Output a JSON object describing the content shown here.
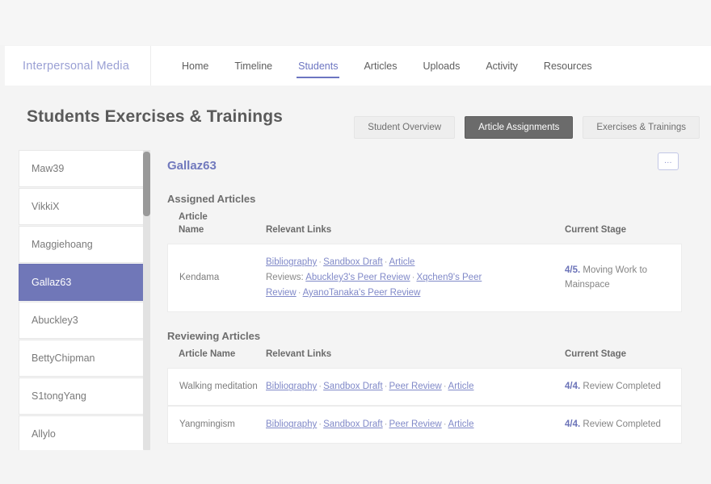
{
  "nav": {
    "brand": "Interpersonal Media",
    "links": [
      {
        "label": "Home",
        "active": false
      },
      {
        "label": "Timeline",
        "active": false
      },
      {
        "label": "Students",
        "active": true
      },
      {
        "label": "Articles",
        "active": false
      },
      {
        "label": "Uploads",
        "active": false
      },
      {
        "label": "Activity",
        "active": false
      },
      {
        "label": "Resources",
        "active": false
      }
    ]
  },
  "header": {
    "title": "Students Exercises & Trainings",
    "tabs": [
      {
        "label": "Student Overview",
        "active": false
      },
      {
        "label": "Article Assignments",
        "active": true
      },
      {
        "label": "Exercises & Trainings",
        "active": false
      }
    ]
  },
  "sidebar": {
    "students": [
      {
        "name": "Maw39",
        "selected": false
      },
      {
        "name": "VikkiX",
        "selected": false
      },
      {
        "name": "Maggiehoang",
        "selected": false
      },
      {
        "name": "Gallaz63",
        "selected": true
      },
      {
        "name": "Abuckley3",
        "selected": false
      },
      {
        "name": "BettyChipman",
        "selected": false
      },
      {
        "name": "S1tongYang",
        "selected": false
      },
      {
        "name": "Allylo",
        "selected": false
      }
    ]
  },
  "main": {
    "student_name": "Gallaz63",
    "more_button_label": "...",
    "assigned": {
      "section_title": "Assigned Articles",
      "headers": {
        "name_line1": "Article",
        "name_line2": "Name",
        "links": "Relevant Links",
        "stage": "Current Stage"
      },
      "rows": [
        {
          "name": "Kendama",
          "links": [
            "Bibliography",
            "Sandbox Draft",
            "Article"
          ],
          "reviews_label": "Reviews:",
          "review_links": [
            "Abuckley3's Peer Review",
            "Xqchen9's Peer Review",
            "AyanoTanaka's Peer Review"
          ],
          "stage_num": "4/5.",
          "stage_text": "Moving Work to Mainspace"
        }
      ]
    },
    "reviewing": {
      "section_title": "Reviewing Articles",
      "headers": {
        "name": "Article Name",
        "links": "Relevant Links",
        "stage": "Current Stage"
      },
      "rows": [
        {
          "name": "Walking meditation",
          "links": [
            "Bibliography",
            "Sandbox Draft",
            "Peer Review",
            "Article"
          ],
          "stage_num": "4/4.",
          "stage_text": "Review Completed"
        },
        {
          "name": "Yangmingism",
          "links": [
            "Bibliography",
            "Sandbox Draft",
            "Peer Review",
            "Article"
          ],
          "stage_num": "4/4.",
          "stage_text": "Review Completed"
        }
      ]
    }
  },
  "colors": {
    "accent": "#6c75c1",
    "selected_bg": "#7077b8",
    "active_tab_bg": "#6b6b6b",
    "link": "#8089c8",
    "page_bg": "#f4f4f4"
  }
}
